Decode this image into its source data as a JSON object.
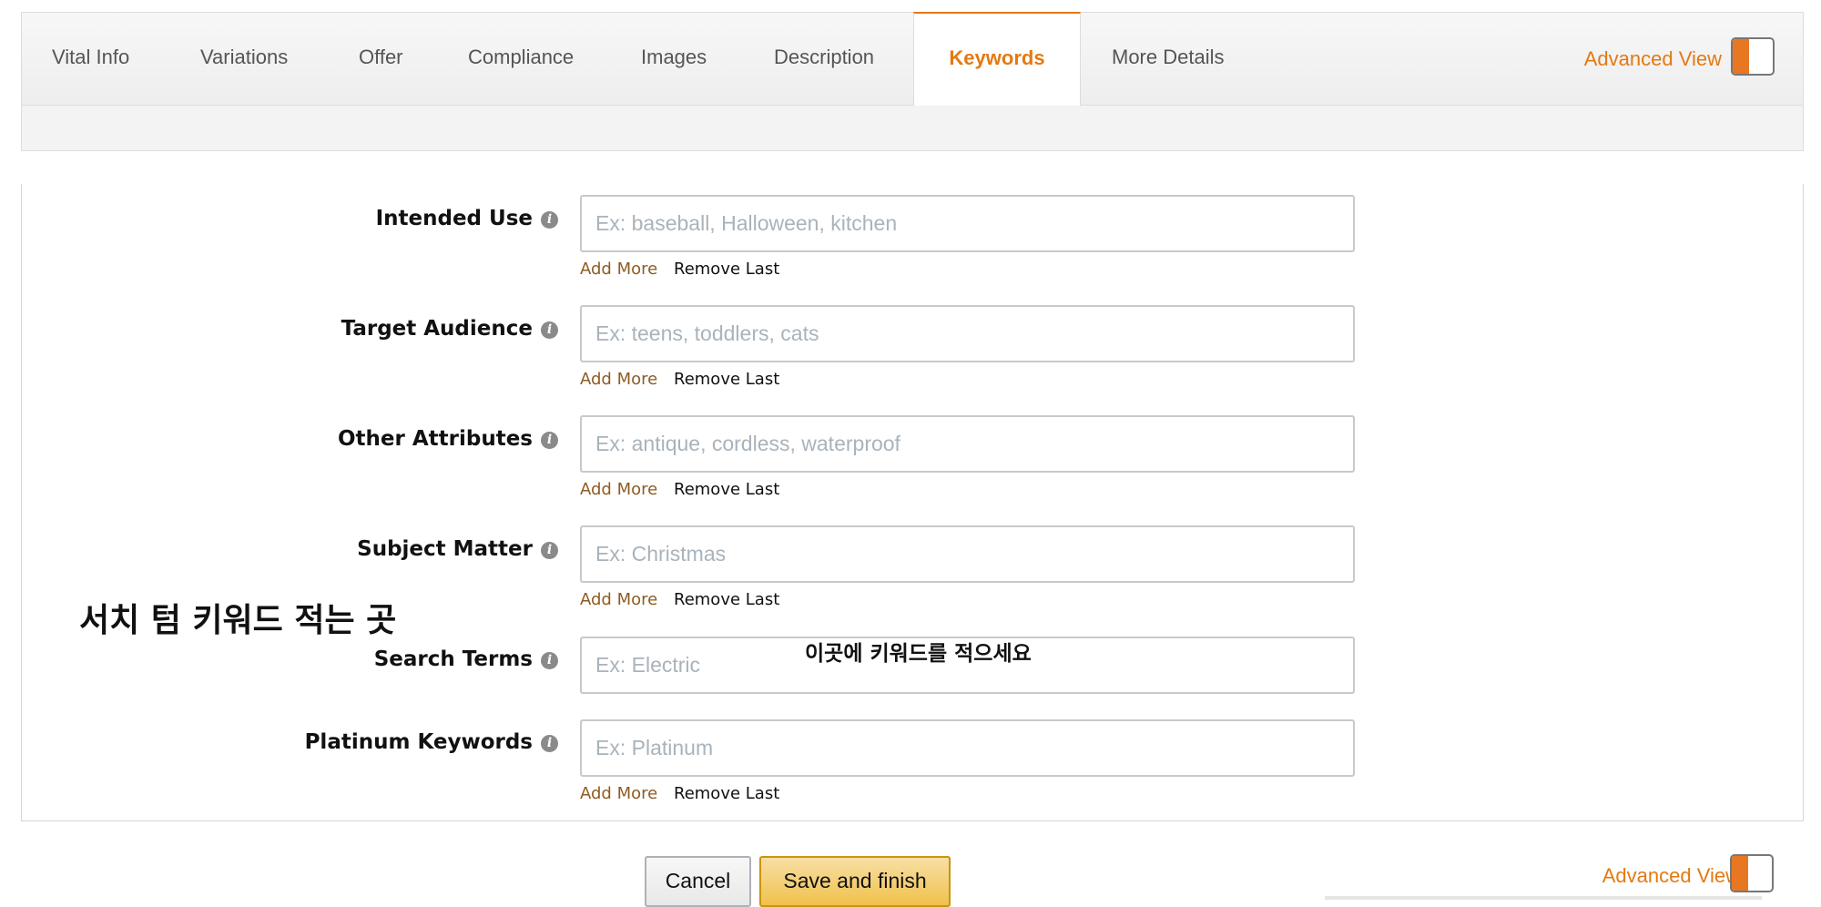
{
  "tabs": [
    {
      "label": "Vital Info",
      "active": false
    },
    {
      "label": "Variations",
      "active": false
    },
    {
      "label": "Offer",
      "active": false
    },
    {
      "label": "Compliance",
      "active": false
    },
    {
      "label": "Images",
      "active": false
    },
    {
      "label": "Description",
      "active": false
    },
    {
      "label": "Keywords",
      "active": true
    },
    {
      "label": "More Details",
      "active": false
    }
  ],
  "advanced_view": {
    "label": "Advanced View",
    "enabled": true
  },
  "info_icon_glyph": "i",
  "fields": [
    {
      "label": "Intended Use",
      "placeholder": "Ex: baseball, Halloween, kitchen",
      "value": "",
      "add_more": "Add More",
      "remove_last": "Remove Last"
    },
    {
      "label": "Target Audience",
      "placeholder": "Ex: teens, toddlers, cats",
      "value": "",
      "add_more": "Add More",
      "remove_last": "Remove Last"
    },
    {
      "label": "Other Attributes",
      "placeholder": "Ex: antique, cordless, waterproof",
      "value": "",
      "add_more": "Add More",
      "remove_last": "Remove Last"
    },
    {
      "label": "Subject Matter",
      "placeholder": "Ex: Christmas",
      "value": "",
      "add_more": "Add More",
      "remove_last": "Remove Last"
    },
    {
      "label": "Search Terms",
      "placeholder": "Ex: Electric",
      "value": ""
    },
    {
      "label": "Platinum Keywords",
      "placeholder": "Ex: Platinum",
      "value": "",
      "add_more": "Add More",
      "remove_last": "Remove Last"
    }
  ],
  "annotations": {
    "left": "서치 텀 키워드 적는 곳",
    "right": "이곳에 키워드를 적으세요"
  },
  "buttons": {
    "cancel": "Cancel",
    "save": "Save and finish"
  },
  "colors": {
    "accent": "#e47911",
    "link_brown": "#8f5b22",
    "placeholder": "#a9b3bb",
    "save_button": "#f0c14b"
  }
}
